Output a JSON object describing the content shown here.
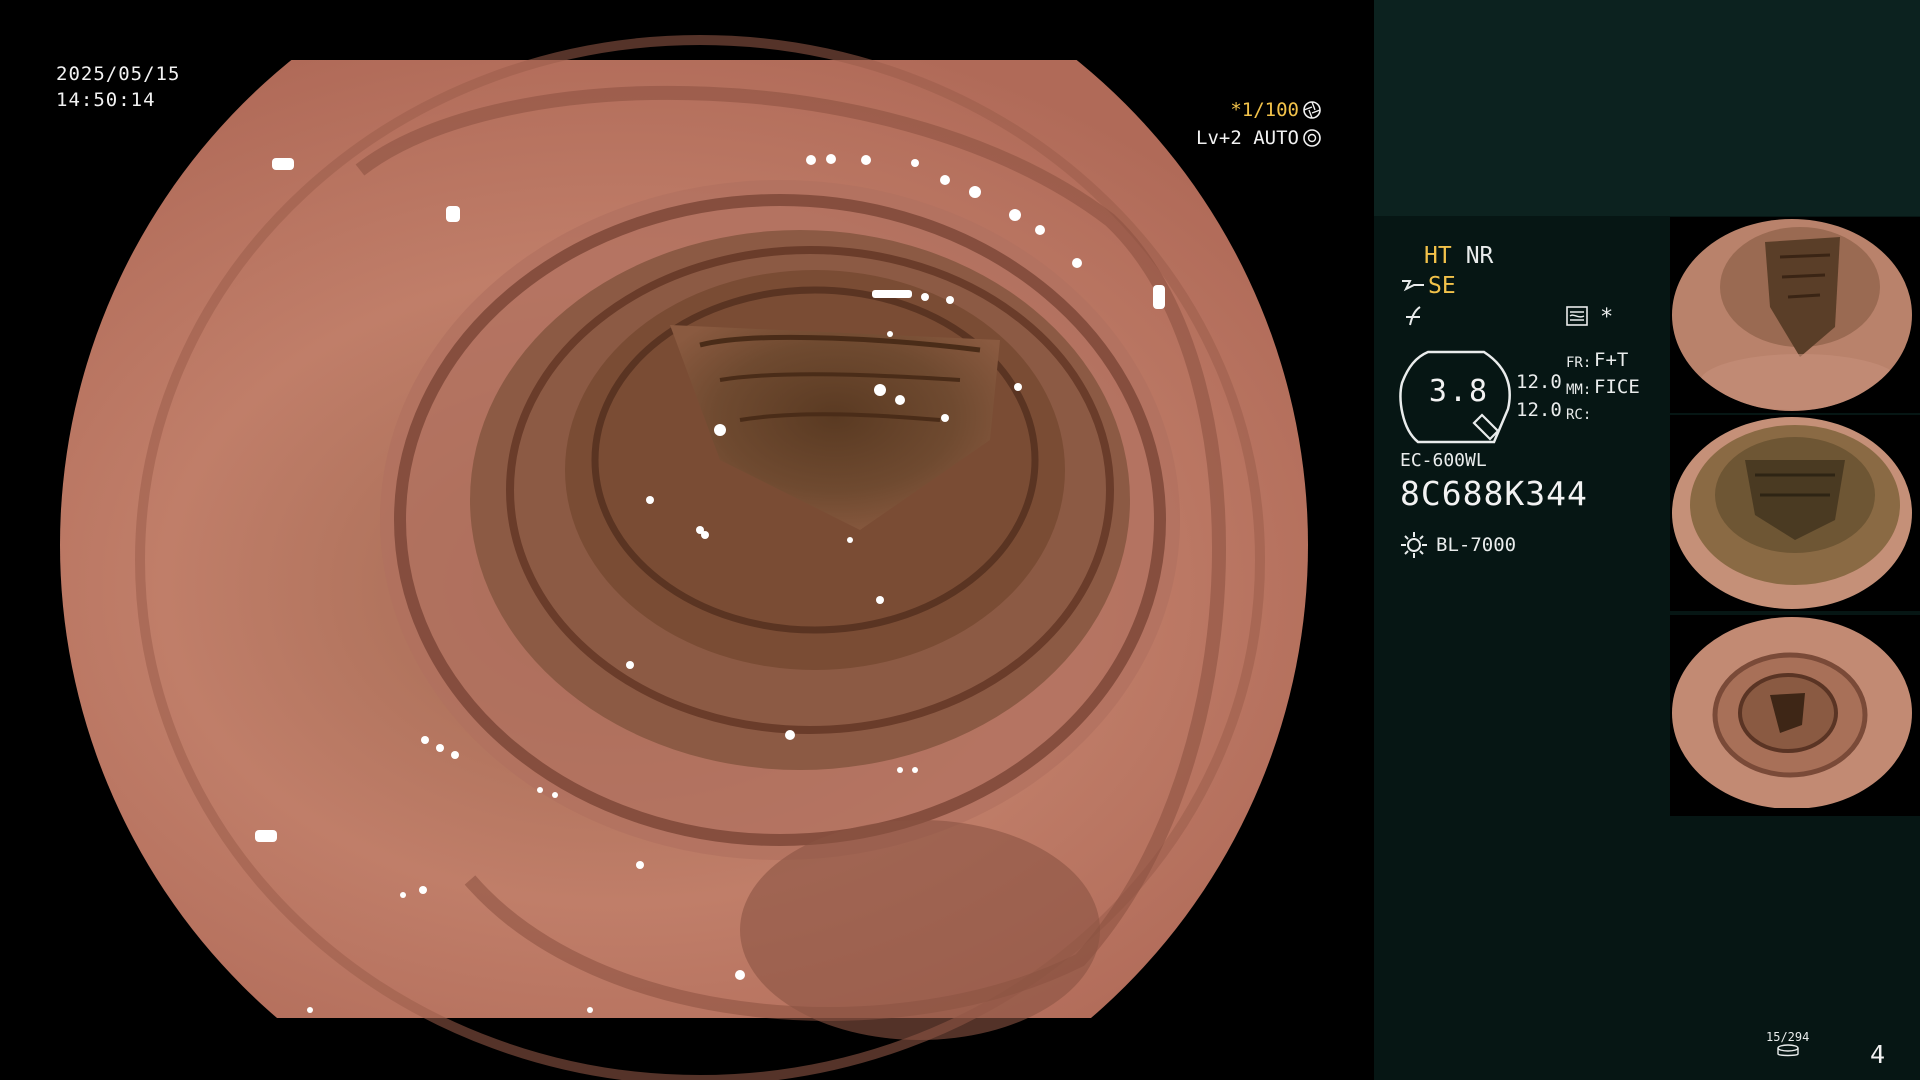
{
  "overlay": {
    "date": "2025/05/15",
    "time": "14:50:14",
    "shutter": "*1/100",
    "level": "Lv+2 AUTO",
    "shutter_icon": "aperture-icon",
    "level_icon": "iris-icon"
  },
  "panel": {
    "processing": {
      "ht": "HT",
      "nr": "NR"
    },
    "se": "SE",
    "se_icon": "enhance-mode-icon",
    "mode_icon": "tone-curve-icon",
    "image_icon": "image-mode-icon",
    "star": "*",
    "gauge_value": "3.8",
    "values": [
      "12.0",
      "12.0"
    ],
    "fr": {
      "label": "FR:",
      "value": "F+T"
    },
    "mm": {
      "label": "MM:",
      "value": "FICE"
    },
    "rc": {
      "label": "RC:",
      "value": ""
    },
    "scope_model": "EC-600WL",
    "serial": "8C688K344",
    "light_source": "BL-7000",
    "light_icon": "light-source-icon",
    "counter": "15/294",
    "counter_icon": "storage-icon",
    "page": "4"
  },
  "colors": {
    "accent": "#f2c24a",
    "panel_bg": "#061614",
    "panel_top": "#0c221f",
    "text": "#e9ecec"
  }
}
